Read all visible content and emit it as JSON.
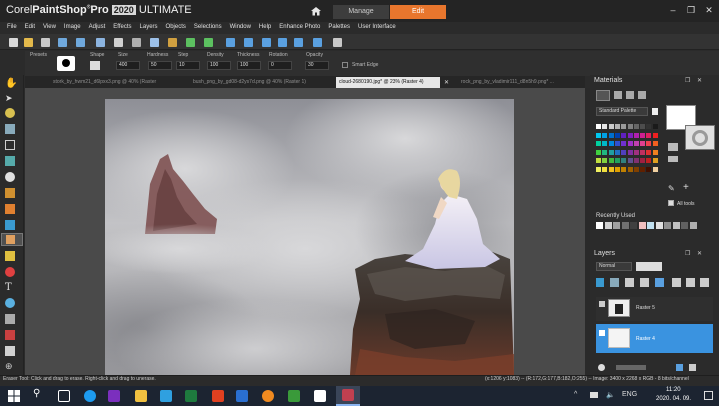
{
  "app": {
    "brand": "Corel",
    "product": "PaintShop",
    "pro": "Pro",
    "year": "2020",
    "edition": "ULTIMATE"
  },
  "mode_tabs": {
    "manage": "Manage",
    "edit": "Edit"
  },
  "menu": [
    "File",
    "Edit",
    "View",
    "Image",
    "Adjust",
    "Effects",
    "Layers",
    "Objects",
    "Selections",
    "Window",
    "Help",
    "Enhance Photo",
    "Palettes",
    "User Interface"
  ],
  "tool_options": {
    "labels": [
      "Presets",
      "Shape",
      "Size",
      "Hardness",
      "Step",
      "Density",
      "Thickness",
      "Rotation",
      "Opacity"
    ],
    "values": [
      "400",
      "50",
      "10",
      "100",
      "100",
      "0",
      "30"
    ],
    "smart_edge": "Smart Edge"
  },
  "doc_tabs": [
    {
      "label": "stork_by_hwm21_d6lpxx3.png @ 40% (Raster 1)",
      "active": false
    },
    {
      "label": "bush_png_by_gd08-d2ys7d.png @ 40% (Raster 1)",
      "active": false
    },
    {
      "label": "cloud-2680190.jpg* @ 23% (Raster 4)",
      "active": true
    },
    {
      "label": "rock_png_by_vladimir111_d8n5h9.png* ...",
      "active": false
    }
  ],
  "materials": {
    "title": "Materials",
    "palette_select": "Standard Palette",
    "recently_used": "Recently Used",
    "all_tools": "All tools",
    "swatch_colors": [
      "#ffffff",
      "#e6e6e6",
      "#cccccc",
      "#b3b3b3",
      "#999999",
      "#808080",
      "#666666",
      "#4d4d4d",
      "#333333",
      "#1a1a1a",
      "#00c8f0",
      "#00a0e6",
      "#0070d0",
      "#0040b0",
      "#6020c0",
      "#8020c0",
      "#b020b0",
      "#d02090",
      "#e02060",
      "#f02020",
      "#00d0a0",
      "#00b8c8",
      "#0088e0",
      "#3050d0",
      "#7030d0",
      "#a030c8",
      "#c040b0",
      "#e04090",
      "#f04050",
      "#f06020",
      "#40d040",
      "#20b880",
      "#20a0a0",
      "#2070c0",
      "#5040c0",
      "#8030a0",
      "#a03080",
      "#c03060",
      "#e03030",
      "#f08020",
      "#c0e040",
      "#80d040",
      "#40b840",
      "#20a060",
      "#308080",
      "#605090",
      "#803070",
      "#a02040",
      "#c02020",
      "#e0a020",
      "#f0f060",
      "#f0e040",
      "#f0c020",
      "#e0a000",
      "#c08000",
      "#a06000",
      "#804000",
      "#602000",
      "#401000",
      "#f0d0a0"
    ],
    "recent_colors": [
      "#ffffff",
      "#d0d0d0",
      "#a0a0a0",
      "#707070",
      "#404040",
      "#f0c0c0",
      "#c0e0f0",
      "#e0e0e0",
      "#909090",
      "#c0c0c0",
      "#606060",
      "#b0b0b0"
    ]
  },
  "layers": {
    "title": "Layers",
    "blend_mode": "Normal",
    "items": [
      {
        "name": "Raster 5",
        "selected": false
      },
      {
        "name": "Raster 4",
        "selected": true
      }
    ]
  },
  "status": {
    "left": "Eraser Tool: Click and drag to erase. Right-click and drag to unerase.",
    "right": "(x:1206 y:1083) -- (R:172,G:177,B:182,O:255) -- Image: 3400 x 2268 x RGB - 8 bits/channel"
  },
  "taskbar": {
    "time": "11:20",
    "date": "2020. 04. 09."
  },
  "colors": {
    "accent_orange": "#e8762d",
    "layer_selected": "#3a93e0"
  }
}
